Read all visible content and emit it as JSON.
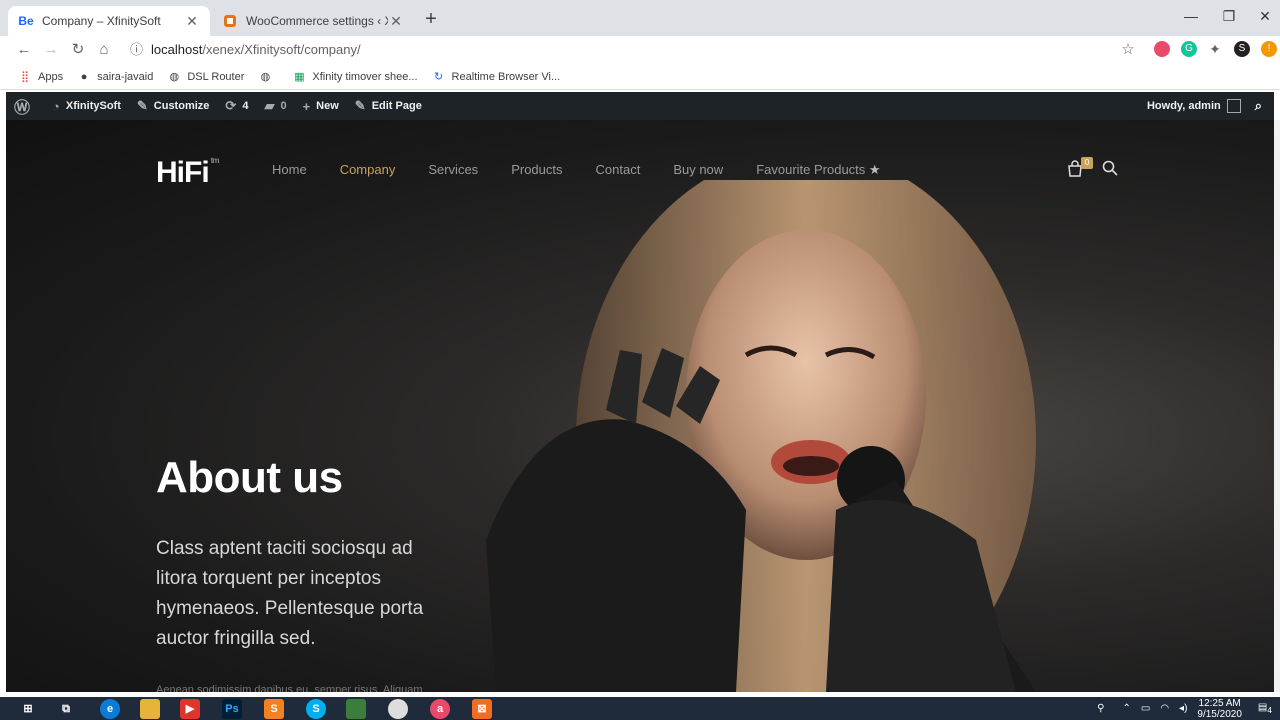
{
  "browser": {
    "tabs": [
      {
        "title": "Company – XfinitySoft",
        "favicon": "Be",
        "active": true
      },
      {
        "title": "WooCommerce settings ‹ XfinityS",
        "favicon": "woo-icon",
        "active": false
      }
    ],
    "url_host": "localhost",
    "url_path": "/xenex/Xfinitysoft/company/",
    "bookmarks": [
      "Apps",
      "saira-javaid",
      "DSL Router",
      "Xfinity timover shee...",
      "Realtime Browser Vi..."
    ],
    "profile_initial": "S"
  },
  "wp_admin": {
    "site_name": "XfinitySoft",
    "customize": "Customize",
    "updates_count": "4",
    "comments_count": "0",
    "new_label": "New",
    "edit_page": "Edit Page",
    "howdy": "Howdy, admin"
  },
  "site": {
    "logo": "HiFi",
    "logo_tm": "tm",
    "menu": [
      "Home",
      "Company",
      "Services",
      "Products",
      "Contact",
      "Buy now",
      "Favourite Products"
    ],
    "active_menu": "Company",
    "cart_count": "0",
    "accent_color": "#c7a35b"
  },
  "hero": {
    "heading": "About us",
    "lead": "Class aptent taciti sociosqu ad litora torquent per inceptos hymenaeos. Pellentesque porta auctor fringilla sed.",
    "small_text": "Aenean sodimissim dapibus eu, semper risus. Aliquam"
  },
  "taskbar": {
    "time": "12:25 AM",
    "date": "9/15/2020",
    "notifications": "4"
  }
}
